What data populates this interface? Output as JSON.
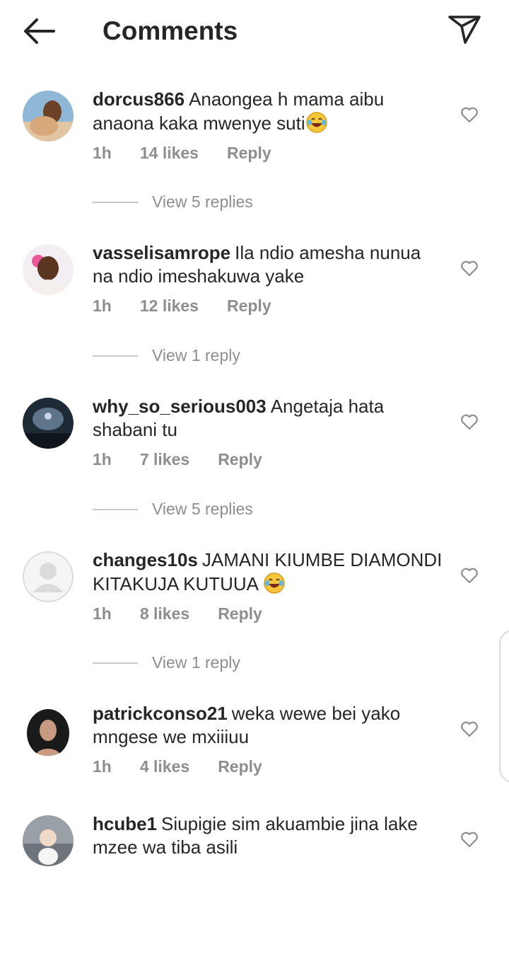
{
  "header": {
    "title": "Comments",
    "back_icon": "arrow-left-icon",
    "send_icon": "paper-plane-icon"
  },
  "comments": [
    {
      "username": "dorcus866",
      "text": "Anaongea h mama aibu anaona kaka mwenye suti",
      "emoji": "😂",
      "time": "1h",
      "likes": "14 likes",
      "reply": "Reply",
      "view_replies": "View 5 replies"
    },
    {
      "username": "vasselisamrope",
      "text": "Ila ndio amesha nunua na ndio imeshakuwa yake",
      "time": "1h",
      "likes": "12 likes",
      "reply": "Reply",
      "view_replies": "View 1 reply"
    },
    {
      "username": "why_so_serious003",
      "text": "Angetaja hata shabani tu",
      "time": "1h",
      "likes": "7 likes",
      "reply": "Reply",
      "view_replies": "View 5 replies"
    },
    {
      "username": "changes10s",
      "text": "JAMANI KIUMBE DIAMONDI KITAKUJA KUTUUA",
      "emoji": "😂",
      "time": "1h",
      "likes": "8 likes",
      "reply": "Reply",
      "view_replies": "View 1 reply"
    },
    {
      "username": "patrickconso21",
      "text": "weka wewe bei yako mngese we mxiiiuu",
      "time": "1h",
      "likes": "4 likes",
      "reply": "Reply"
    },
    {
      "username": "hcube1",
      "text": "Siupigie sim akuambie jina lake mzee wa tiba asili"
    }
  ],
  "icons": {
    "like": "heart-outline-icon",
    "emoji": "face-with-tears-of-joy-icon"
  },
  "colors": {
    "text": "#262626",
    "secondary": "#8e8e8e",
    "divider": "#c7c7c7"
  }
}
